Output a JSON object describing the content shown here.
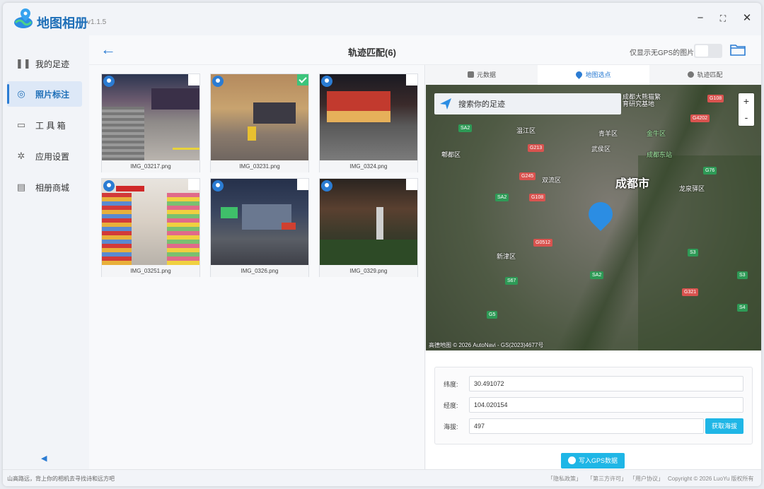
{
  "app": {
    "name": "地图相册",
    "version": "v1.1.5"
  },
  "window_controls": {
    "minimize": "−",
    "maximize": "⛶",
    "close": "✕"
  },
  "sidebar": {
    "items": [
      {
        "label": "我的足迹",
        "icon": "footprints-icon"
      },
      {
        "label": "照片标注",
        "icon": "pin-tag-icon",
        "active": true
      },
      {
        "label": "工 具 箱",
        "icon": "toolbox-icon"
      },
      {
        "label": "应用设置",
        "icon": "settings-icon"
      },
      {
        "label": "相册商城",
        "icon": "store-icon"
      }
    ],
    "collapse": "◀"
  },
  "header": {
    "title": "轨迹匹配(6)",
    "gps_filter_label": "仅显示无GPS的图片:",
    "back": "←"
  },
  "photos": [
    {
      "name": "IMG_03217.png",
      "has_gps": true,
      "checked": false
    },
    {
      "name": "IMG_03231.png",
      "has_gps": true,
      "checked": true
    },
    {
      "name": "IMG_0324.png",
      "has_gps": true,
      "checked": false
    },
    {
      "name": "IMG_03251.png",
      "has_gps": true,
      "checked": false
    },
    {
      "name": "IMG_0326.png",
      "has_gps": true,
      "checked": false
    },
    {
      "name": "IMG_0329.png",
      "has_gps": true,
      "checked": false
    }
  ],
  "tabs": [
    {
      "label": "元数据"
    },
    {
      "label": "地图选点",
      "active": true
    },
    {
      "label": "轨迹匹配"
    }
  ],
  "map": {
    "search_placeholder": "搜索你的足迹",
    "zoom_in": "+",
    "zoom_out": "-",
    "city": "成都市",
    "labels": [
      "成都大熊猫繁育研究基地",
      "温江区",
      "郫都区",
      "青羊区",
      "武侯区",
      "双流区",
      "龙泉驿区",
      "新津区",
      "成都东站",
      "金牛区"
    ],
    "roads": [
      "G108",
      "SA2",
      "G213",
      "G4202",
      "G76",
      "G245",
      "G108",
      "S3",
      "G5",
      "SA2",
      "S4",
      "S67",
      "G0512",
      "S3",
      "G321",
      "SA2"
    ],
    "attribution": "高德地图 © 2026 AutoNavi - GS(2023)4677号"
  },
  "form": {
    "lat_label": "纬度:",
    "lat_value": "30.491072",
    "lng_label": "经度:",
    "lng_value": "104.020154",
    "alt_label": "海拔:",
    "alt_value": "497",
    "get_alt_button": "获取海拔"
  },
  "write_button": "写入GPS数据",
  "footer": {
    "slogan": "山高路远，背上你的相机去寻找诗和远方吧",
    "links": [
      "「隐私政策」",
      "「第三方许可」",
      "「用户协议」"
    ],
    "copyright": "Copyright © 2026 LuoYu 版权所有"
  }
}
